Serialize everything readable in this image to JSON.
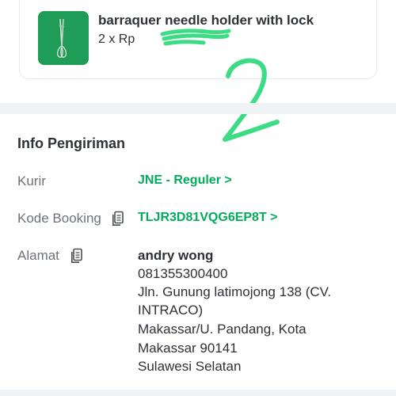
{
  "product": {
    "name": "barraquer needle holder with lock",
    "price_text": "2 x Rp",
    "thumbnail_icon": "needle-holder-icon",
    "price_redaction_color": "#3ddc84"
  },
  "annotation": {
    "handwritten_text": "2",
    "color": "#3ddc84"
  },
  "shipping": {
    "title": "Info Pengiriman",
    "courier": {
      "label": "Kurir",
      "value": "JNE - Reguler >"
    },
    "booking": {
      "label": "Kode Booking",
      "value": "TLJR3D81VQG6EP8T >",
      "icon": "copy-icon"
    },
    "address": {
      "label": "Alamat",
      "icon": "copy-icon",
      "name": "andry wong",
      "lines": [
        "081355300400",
        "Jln. Gunung latimojong 138 (CV.",
        "INTRACO)",
        "Makassar/U. Pandang, Kota",
        "Makassar 90141",
        "Sulawesi Selatan"
      ]
    }
  },
  "colors": {
    "accent_green": "#03ac5c",
    "text_primary": "#2e3137",
    "text_secondary": "#6d7279",
    "divider": "#f0f3f5"
  }
}
